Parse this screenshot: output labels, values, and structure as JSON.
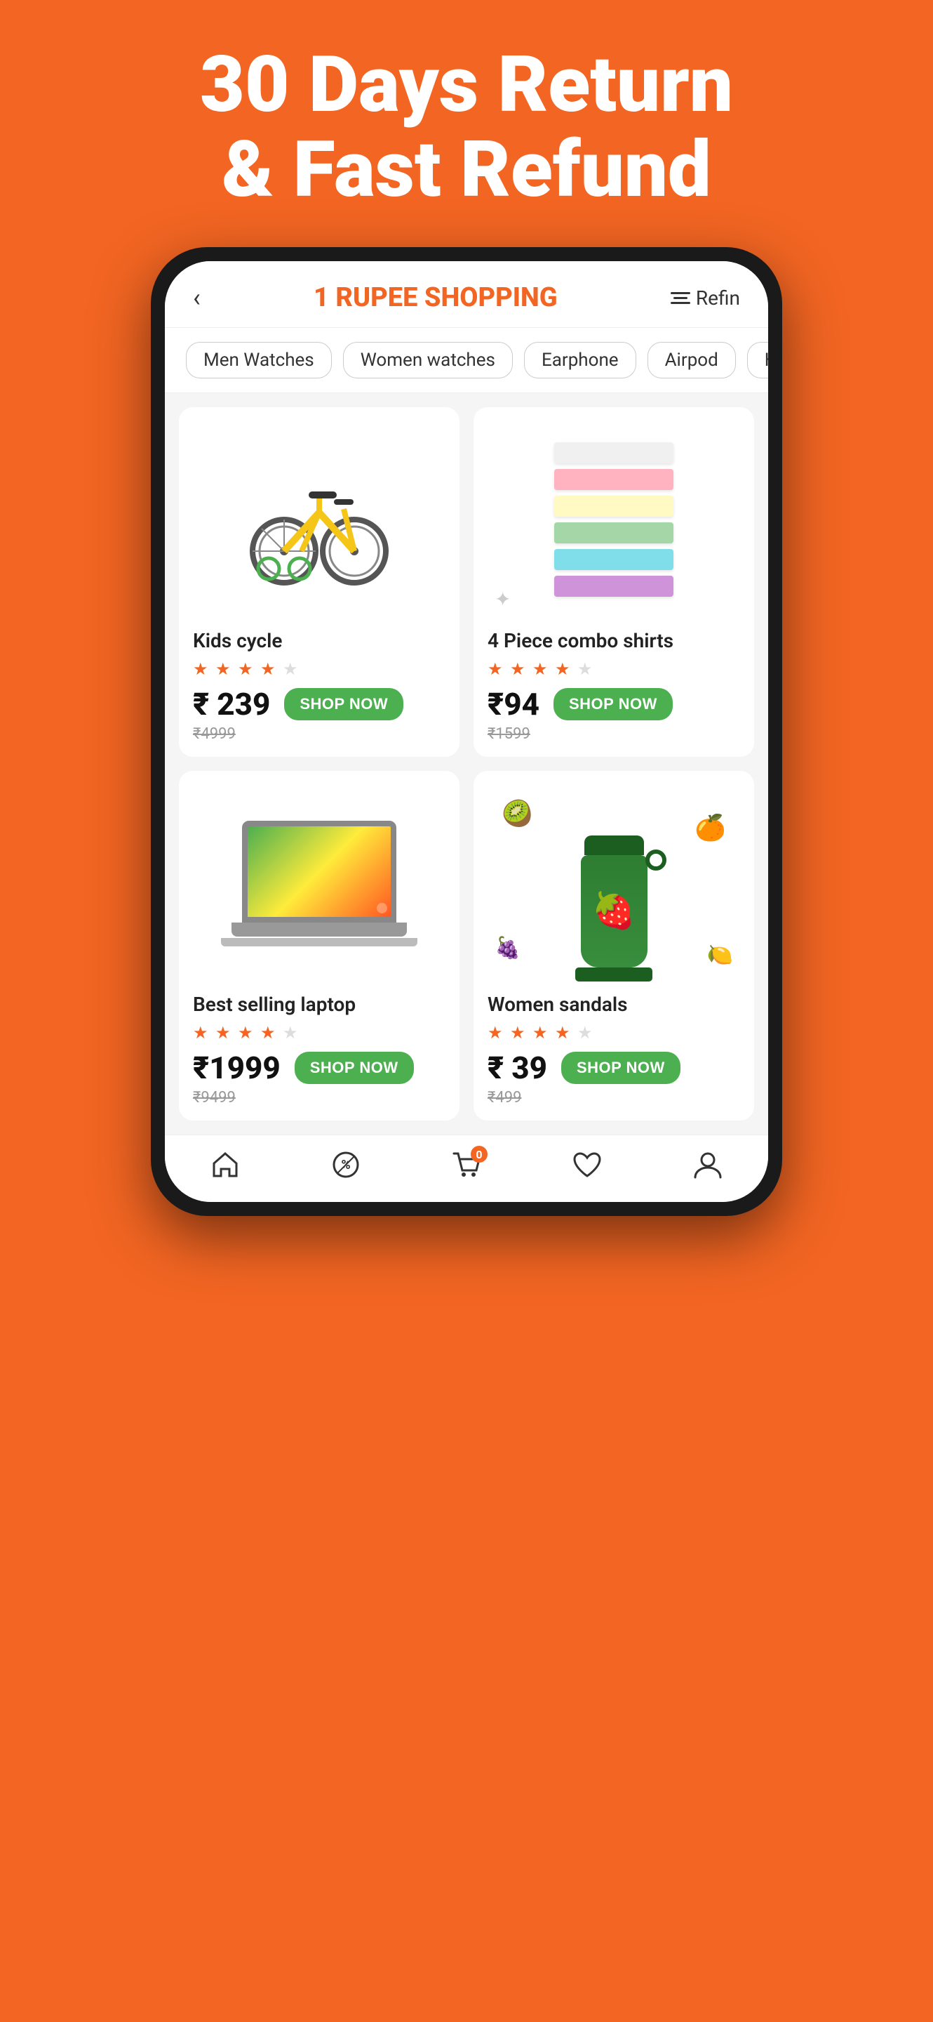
{
  "hero": {
    "line1": "30 Days Return",
    "line2": "& Fast Refund"
  },
  "app": {
    "title": "1 RUPEE SHOPPING",
    "back_label": "‹",
    "filter_label": "Refin"
  },
  "categories": [
    {
      "label": "Men Watches",
      "active": false
    },
    {
      "label": "Women watches",
      "active": false
    },
    {
      "label": "Earphone",
      "active": false
    },
    {
      "label": "Airpod",
      "active": false
    },
    {
      "label": "Helmets",
      "active": false
    }
  ],
  "products": [
    {
      "name": "Kids cycle",
      "rating": 4,
      "total_stars": 5,
      "current_price": "₹ 239",
      "original_price": "₹4999",
      "shop_label": "SHOP NOW",
      "icon": "bike"
    },
    {
      "name": "4 Piece combo shirts",
      "rating": 4,
      "total_stars": 5,
      "current_price": "₹94",
      "original_price": "₹1599",
      "shop_label": "SHOP NOW",
      "icon": "shirts"
    },
    {
      "name": "Best selling laptop",
      "rating": 4,
      "total_stars": 5,
      "current_price": "₹1999",
      "original_price": "₹9499",
      "shop_label": "SHOP NOW",
      "icon": "laptop"
    },
    {
      "name": "Women sandals",
      "rating": 4,
      "total_stars": 5,
      "current_price": "₹ 39",
      "original_price": "₹499",
      "shop_label": "SHOP NOW",
      "icon": "blender"
    }
  ],
  "nav": {
    "home_label": "🏠",
    "offers_label": "🏷",
    "cart_label": "🛒",
    "cart_count": "0",
    "wishlist_label": "♡",
    "profile_label": "👤"
  },
  "colors": {
    "accent": "#F26522",
    "green": "#4CAF50",
    "star": "#F26522"
  }
}
